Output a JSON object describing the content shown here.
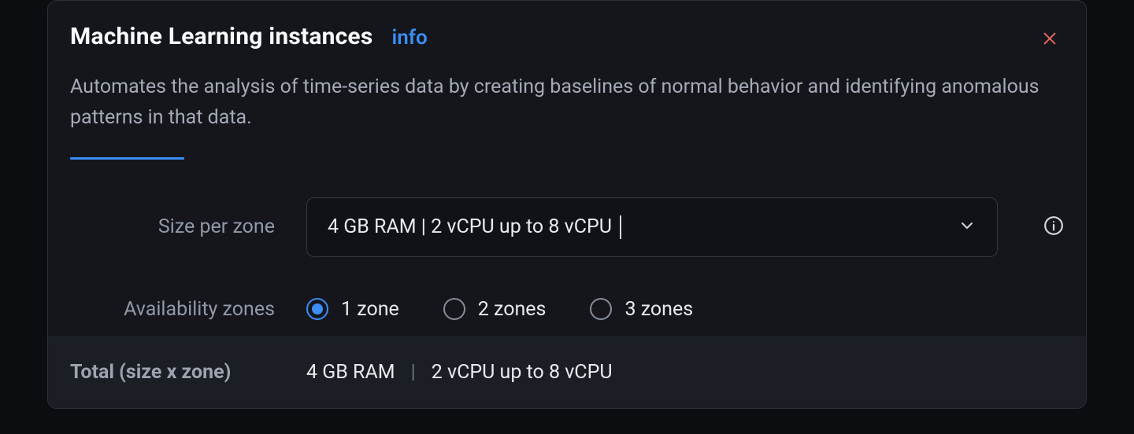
{
  "header": {
    "title": "Machine Learning instances",
    "info_link": "info",
    "description": "Automates the analysis of time-series data by creating baselines of normal behavior and identifying anomalous patterns in that data."
  },
  "form": {
    "size_label": "Size per zone",
    "size_value": "4 GB RAM | 2 vCPU up to 8 vCPU",
    "zones_label": "Availability zones",
    "zone_options": [
      {
        "label": "1 zone",
        "selected": true
      },
      {
        "label": "2 zones",
        "selected": false
      },
      {
        "label": "3 zones",
        "selected": false
      }
    ]
  },
  "total": {
    "label": "Total (size x zone)",
    "ram": "4 GB RAM",
    "cpu": "2 vCPU up to 8 vCPU"
  }
}
